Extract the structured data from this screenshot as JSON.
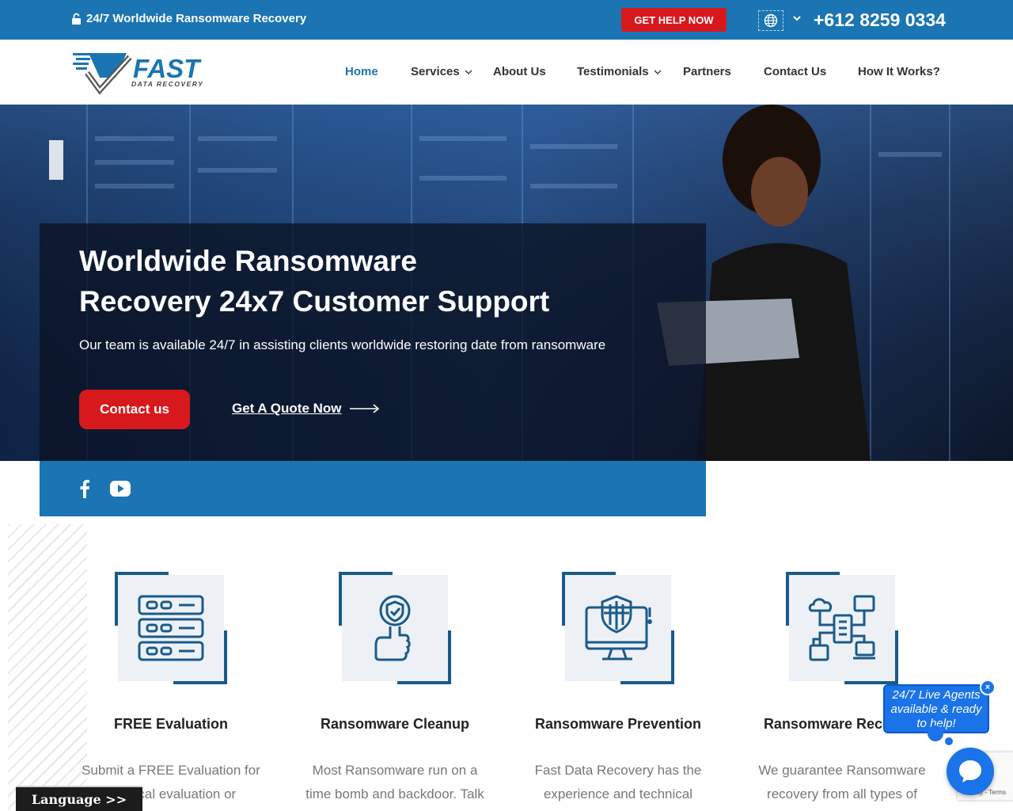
{
  "topbar": {
    "message": "24/7 Worldwide Ransomware Recovery",
    "help_button": "GET HELP NOW",
    "phone": "+612 8259 0334"
  },
  "brand": {
    "logo_word": "FAST",
    "logo_tagline": "DATA RECOVERY"
  },
  "nav": {
    "items": [
      {
        "label": "Home",
        "active": true
      },
      {
        "label": "Services",
        "has_dropdown": true
      },
      {
        "label": "About Us"
      },
      {
        "label": "Testimonials",
        "has_dropdown": true
      },
      {
        "label": "Partners"
      },
      {
        "label": "Contact Us"
      },
      {
        "label": "How It Works?"
      }
    ]
  },
  "hero": {
    "title_line1": "Worldwide Ransomware",
    "title_line2": "Recovery 24x7 Customer Support",
    "subtitle": "Our team is available 24/7 in assisting clients worldwide restoring date from ransomware",
    "primary_cta": "Contact us",
    "secondary_cta": "Get A Quote Now"
  },
  "social": [
    "facebook-icon",
    "youtube-icon"
  ],
  "features": [
    {
      "title": "FREE Evaluation",
      "desc_line1": "Submit a FREE Evaluation for",
      "desc_line2": "a critical evaluation or",
      "icon": "server-stack-icon"
    },
    {
      "title": "Ransomware Cleanup",
      "desc_line1": "Most Ransomware run on a",
      "desc_line2": "time bomb and backdoor. Talk",
      "icon": "hand-shield-check-icon"
    },
    {
      "title": "Ransomware Prevention",
      "desc_line1": "Fast Data Recovery has the",
      "desc_line2": "experience and technical",
      "icon": "monitor-shield-icon"
    },
    {
      "title": "Ransomware Recovery",
      "desc_line1": "We guarantee Ransomware",
      "desc_line2": "recovery from all types of",
      "icon": "network-devices-icon"
    }
  ],
  "chat": {
    "bubble_text": "24/7 Live Agents available & ready to help!",
    "close": "×"
  },
  "recaptcha": {
    "links": "Privacy - Terms"
  },
  "language_bar": "Language >>",
  "colors": {
    "primary_blue": "#1a75b2",
    "accent_red": "#d7191d",
    "dark_navy": "#0c1e3d"
  }
}
